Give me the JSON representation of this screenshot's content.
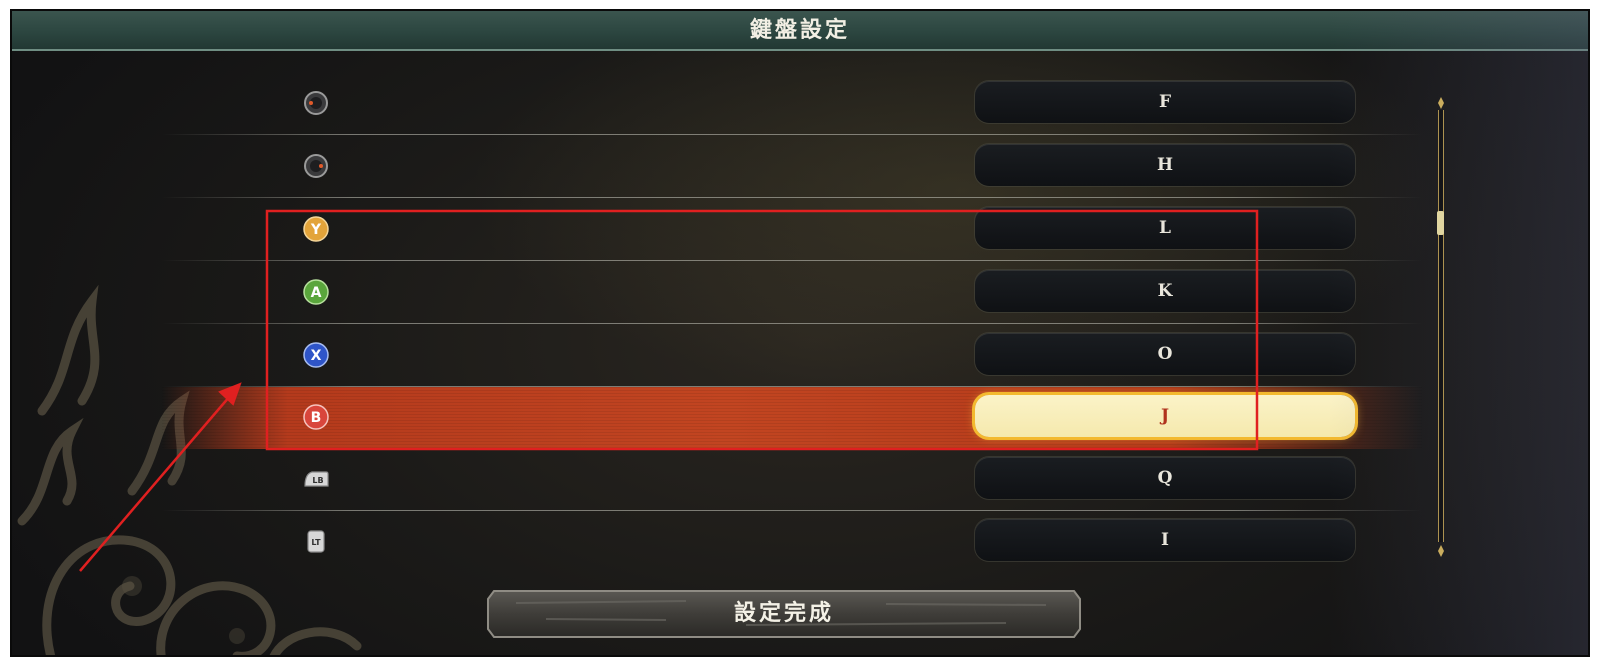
{
  "title": "鍵盤設定",
  "bindings": [
    {
      "button_icon": "right-stick-icon",
      "key": "F"
    },
    {
      "button_icon": "right-stick-icon",
      "key": "H"
    },
    {
      "button_icon": "y-button-icon",
      "button_label": "Y",
      "key": "L"
    },
    {
      "button_icon": "a-button-icon",
      "button_label": "A",
      "key": "K"
    },
    {
      "button_icon": "x-button-icon",
      "button_label": "X",
      "key": "O"
    },
    {
      "button_icon": "b-button-icon",
      "button_label": "B",
      "key": "J",
      "selected": true
    },
    {
      "button_icon": "lb-button-icon",
      "button_label": "LB",
      "key": "Q"
    },
    {
      "button_icon": "lt-button-icon",
      "button_label": "LT",
      "key": "I"
    }
  ],
  "confirm_label": "設定完成",
  "colors": {
    "title_bar": "#2c4640",
    "highlight": "#c24521",
    "selected_key_bg": "#f5e9ad",
    "selected_key_text": "#b0331d",
    "annotation_red": "#e02020",
    "y_button": "#e3a43a",
    "a_button": "#5aa63c",
    "x_button": "#2f55c8",
    "b_button": "#d9463c"
  }
}
